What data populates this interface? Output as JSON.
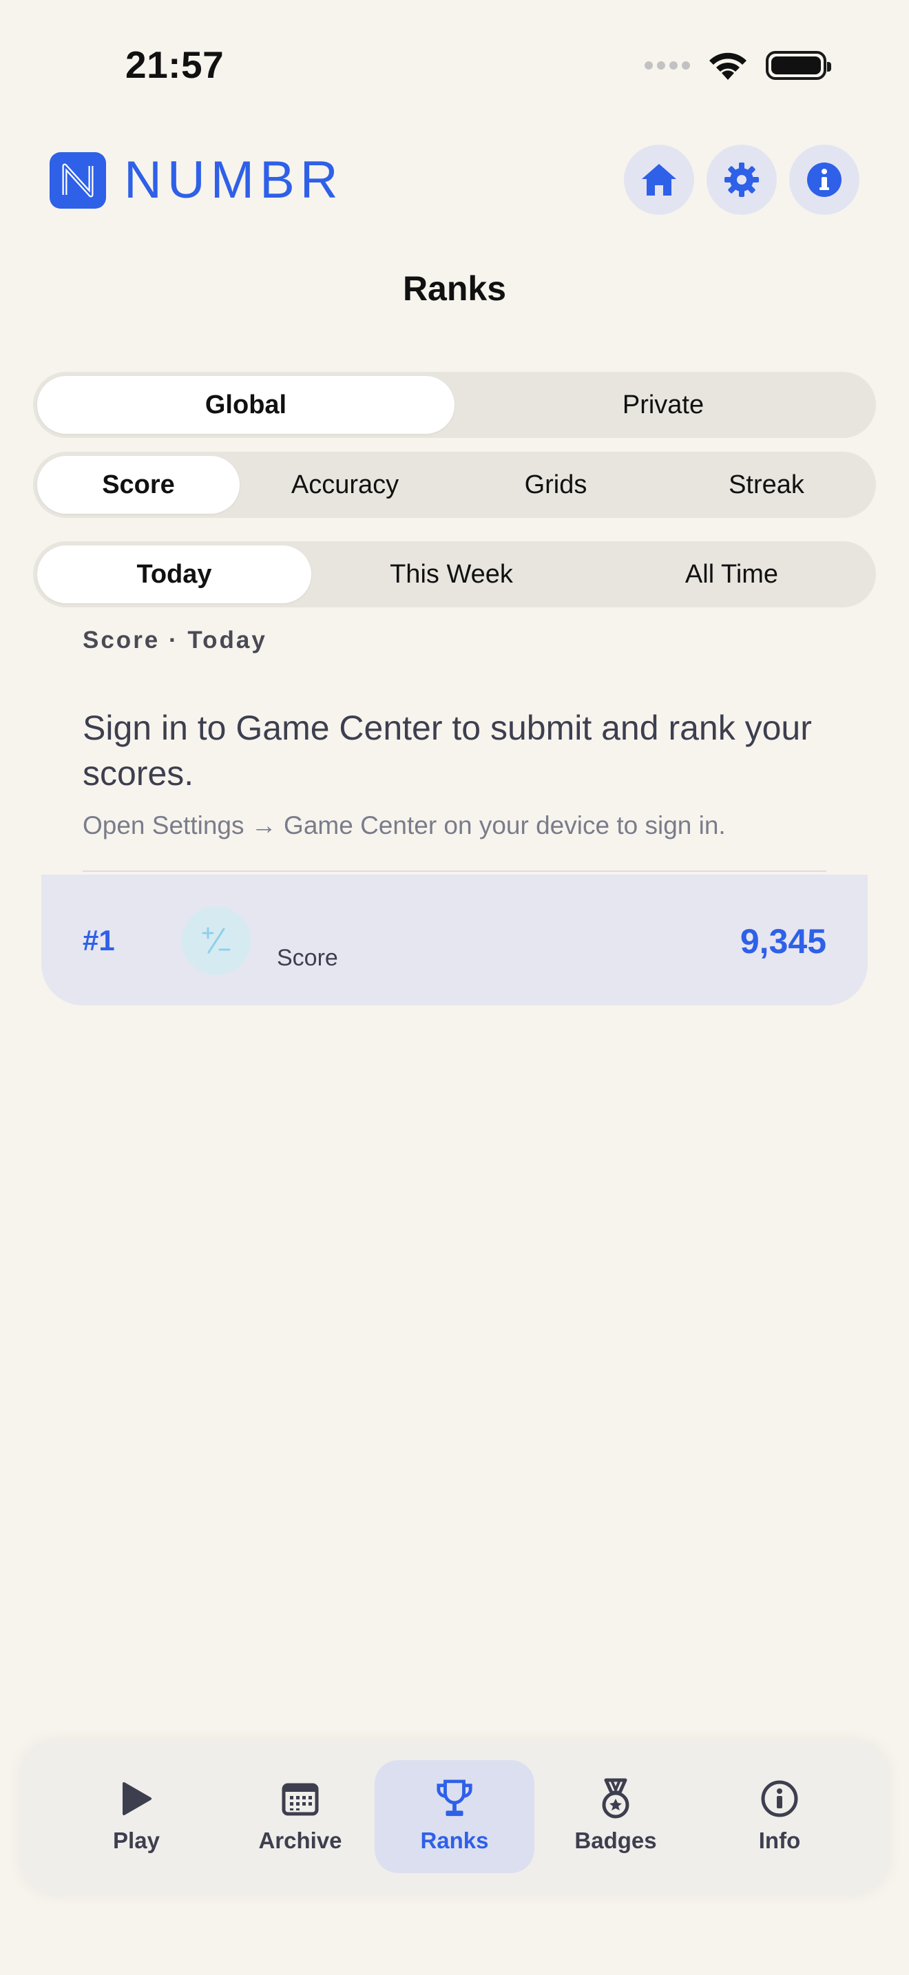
{
  "status": {
    "time": "21:57"
  },
  "app": {
    "name": "NUMBR"
  },
  "header": {
    "buttons": [
      {
        "icon": "house-icon"
      },
      {
        "icon": "gear-icon"
      },
      {
        "icon": "info-icon"
      }
    ]
  },
  "page_title": "Ranks",
  "scope_tabs": [
    {
      "label": "Global",
      "active": true
    },
    {
      "label": "Private",
      "active": false
    }
  ],
  "metric_tabs": [
    {
      "label": "Score",
      "active": true
    },
    {
      "label": "Accuracy",
      "active": false
    },
    {
      "label": "Grids",
      "active": false
    },
    {
      "label": "Streak",
      "active": false
    }
  ],
  "period_tabs": [
    {
      "label": "Today",
      "active": true
    },
    {
      "label": "This Week",
      "active": false
    },
    {
      "label": "All Time",
      "active": false
    }
  ],
  "section_label": "Score · Today",
  "signin": {
    "message": "Sign in to Game Center to submit and rank your scores.",
    "hint": "Open Settings → Game Center on your device to sign in."
  },
  "entry": {
    "rank": "#1",
    "avatar_icon": "plus-minus-icon",
    "label": "Score",
    "value": "9,345"
  },
  "tabbar": [
    {
      "label": "Play",
      "icon": "play-icon",
      "active": false
    },
    {
      "label": "Archive",
      "icon": "calendar-icon",
      "active": false
    },
    {
      "label": "Ranks",
      "icon": "trophy-icon",
      "active": true
    },
    {
      "label": "Badges",
      "icon": "medal-icon",
      "active": false
    },
    {
      "label": "Info",
      "icon": "info-icon",
      "active": false
    }
  ],
  "colors": {
    "accent": "#2E60E8",
    "background": "#F7F4EE",
    "segment_bg": "#E8E5DF",
    "card_bg": "#E6E6F0"
  }
}
